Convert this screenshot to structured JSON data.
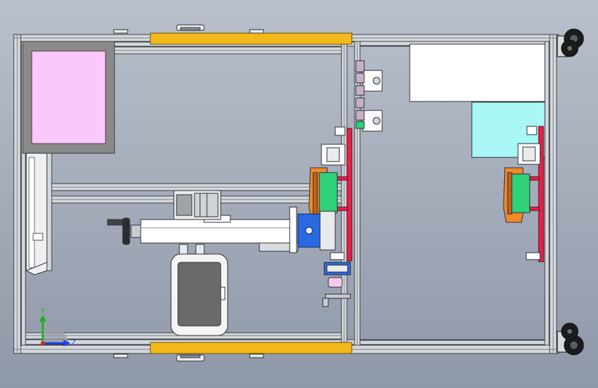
{
  "view": {
    "background_top": "#b9c0cc",
    "background_bottom": "#8f98a8"
  },
  "triad": {
    "y_label": "Y",
    "z_label": "Z",
    "y_color": "#22b022",
    "z_color": "#2040e0",
    "origin_color": "#e02020"
  },
  "colors": {
    "frame_profile": "#d4d8dc",
    "profile_edge": "#3a3f44",
    "yellow_guard": "#f4b81a",
    "pink_panel": "#fcc8fb",
    "panel_frame": "#8a8a8a",
    "white_box": "#ffffff",
    "cyan_box": "#a8f6f6",
    "orange_gripper": "#f08a2a",
    "green_block": "#2fd07a",
    "red_mount": "#e8204a",
    "blue_block": "#2a6ae0",
    "dark_screen": "#6a6a68"
  }
}
